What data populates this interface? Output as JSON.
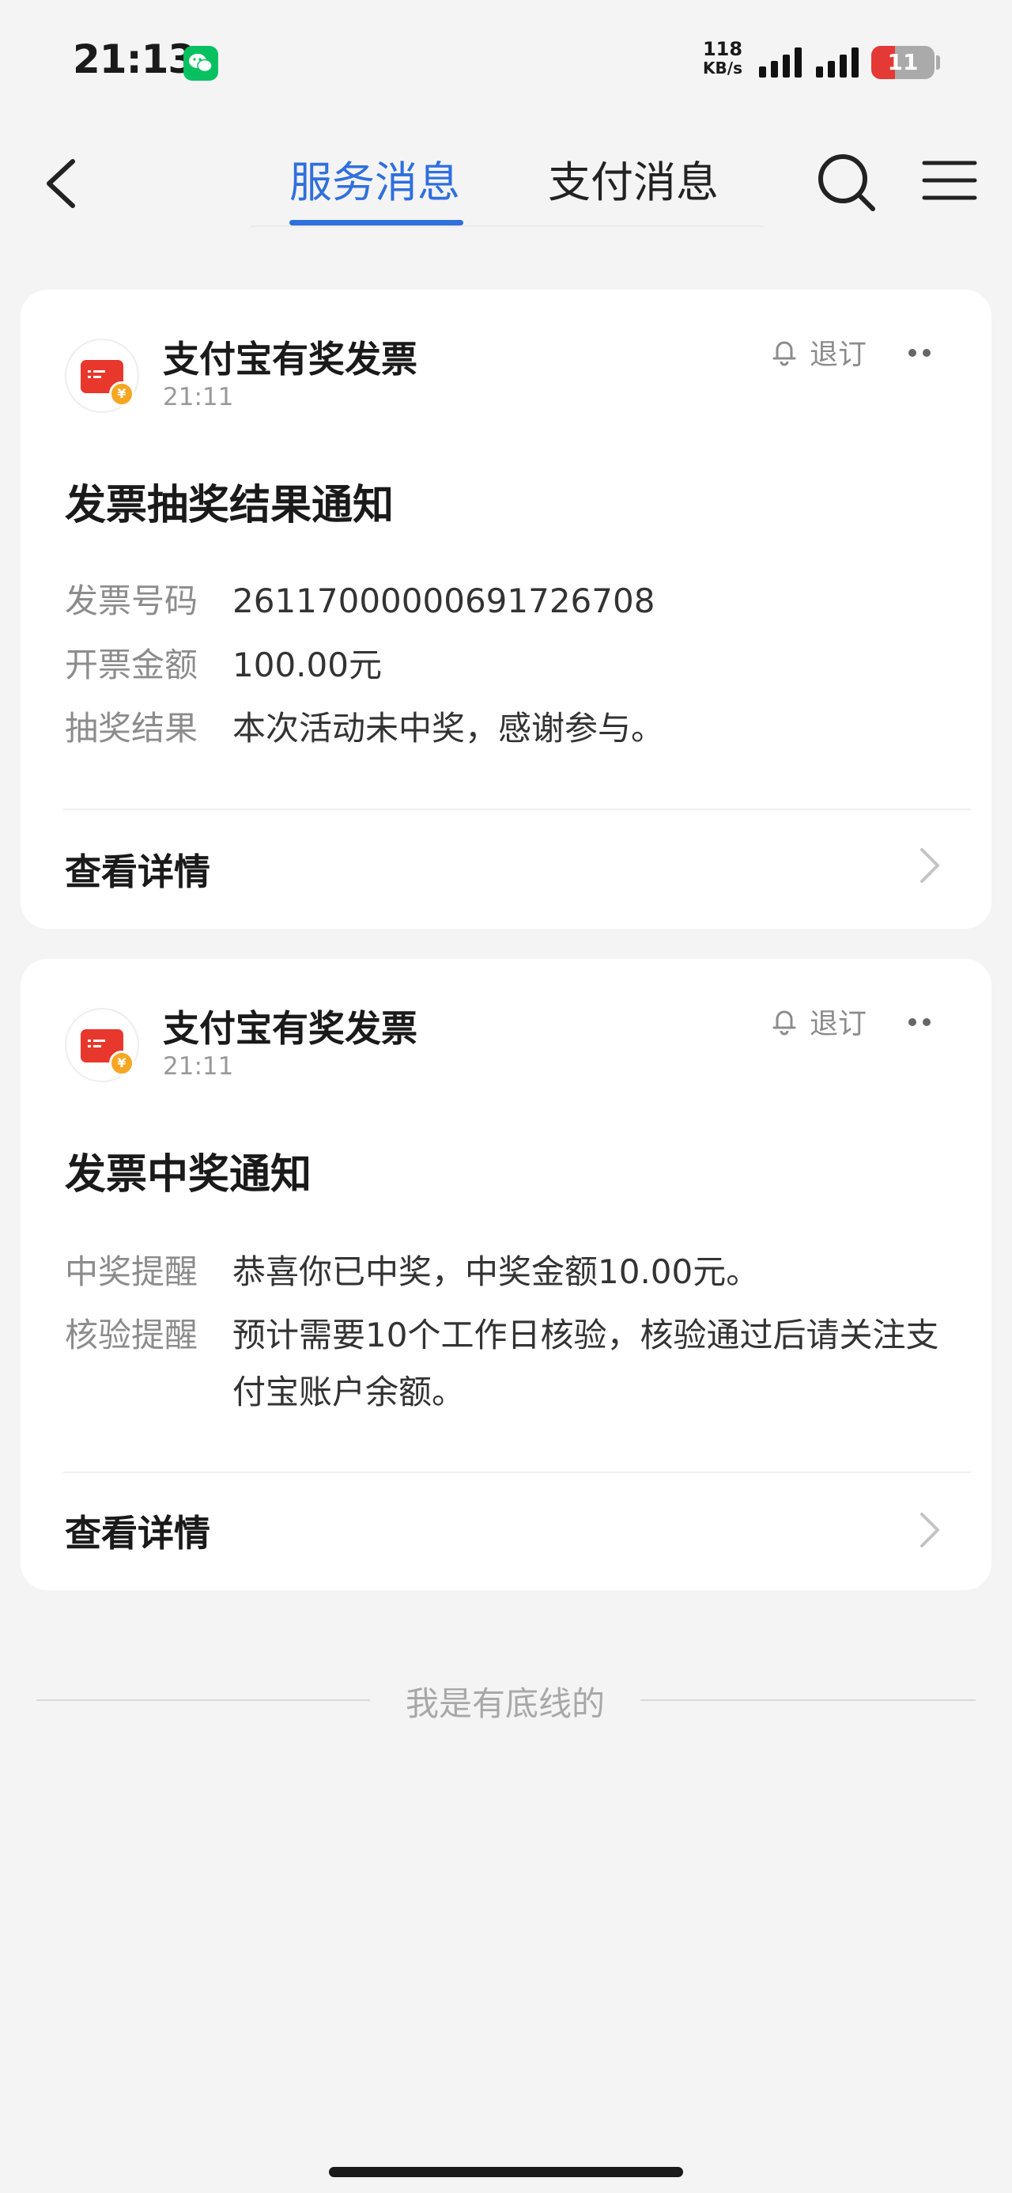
{
  "status_bar": {
    "time": "21:13",
    "net_speed_value": "118",
    "net_speed_unit": "KB/s",
    "battery": "11"
  },
  "nav": {
    "tabs": [
      {
        "label": "服务消息",
        "active": true
      },
      {
        "label": "支付消息",
        "active": false
      }
    ]
  },
  "cards": [
    {
      "app_name": "支付宝有奖发票",
      "time": "21:11",
      "unsubscribe": "退订",
      "title": "发票抽奖结果通知",
      "rows": [
        {
          "key": "发票号码",
          "value": "26117000000691726708"
        },
        {
          "key": "开票金额",
          "value": "100.00元"
        },
        {
          "key": "抽奖结果",
          "value": "本次活动未中奖，感谢参与。"
        }
      ],
      "detail": "查看详情"
    },
    {
      "app_name": "支付宝有奖发票",
      "time": "21:11",
      "unsubscribe": "退订",
      "title": "发票中奖通知",
      "rows": [
        {
          "key": "中奖提醒",
          "value": "恭喜你已中奖，中奖金额10.00元。"
        },
        {
          "key": "核验提醒",
          "value": "预计需要10个工作日核验，核验通过后请关注支付宝账户余额。"
        }
      ],
      "detail": "查看详情"
    }
  ],
  "footer": {
    "text": "我是有底线的"
  },
  "colors": {
    "accent": "#2f6fde",
    "background": "#f4f4f4",
    "logo_red": "#e8372c",
    "logo_coin": "#f6a623",
    "battery_low": "#e53935"
  },
  "icons": {
    "wechat": "wechat-icon",
    "back": "back-icon",
    "search": "search-icon",
    "menu": "menu-icon",
    "bell": "bell-icon",
    "more": "more-icon",
    "chevron": "chevron-right-icon"
  }
}
